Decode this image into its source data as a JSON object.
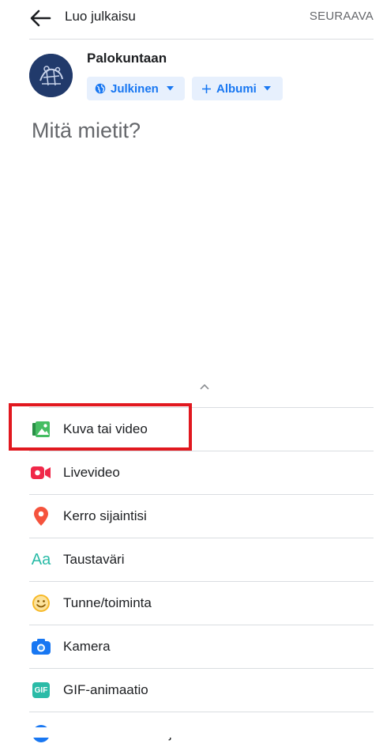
{
  "header": {
    "back_icon": "arrow-left-icon",
    "title": "Luo julkaisu",
    "next_label": "SEURAAVA"
  },
  "profile": {
    "name": "Palokuntaan",
    "audience_chip": "Julkinen",
    "album_chip": "Albumi"
  },
  "composer": {
    "placeholder": "Mitä mietit?"
  },
  "sheet": {
    "expand_icon": "chevron-up-icon",
    "items": [
      {
        "label": "Kuva tai video",
        "icon": "photo-icon",
        "color": "#45bd62"
      },
      {
        "label": "Livevideo",
        "icon": "live-video-icon",
        "color": "#f02849"
      },
      {
        "label": "Kerro sijaintisi",
        "icon": "location-pin-icon",
        "color": "#f5533d"
      },
      {
        "label": "Taustaväri",
        "icon": "text-aa-icon",
        "icon_text": "Aa",
        "color": "#2abba7"
      },
      {
        "label": "Tunne/toiminta",
        "icon": "smiley-icon",
        "color": "#f7b928"
      },
      {
        "label": "Kamera",
        "icon": "camera-icon",
        "color": "#1877f2"
      },
      {
        "label": "GIF-animaatio",
        "icon": "gif-icon",
        "icon_text": "GIF",
        "color": "#2abba7"
      },
      {
        "label": "Vastaanota viestejä",
        "icon": "messenger-icon",
        "color": "#1877f2"
      }
    ]
  },
  "annotation": {
    "highlight_color": "#e1181f"
  }
}
